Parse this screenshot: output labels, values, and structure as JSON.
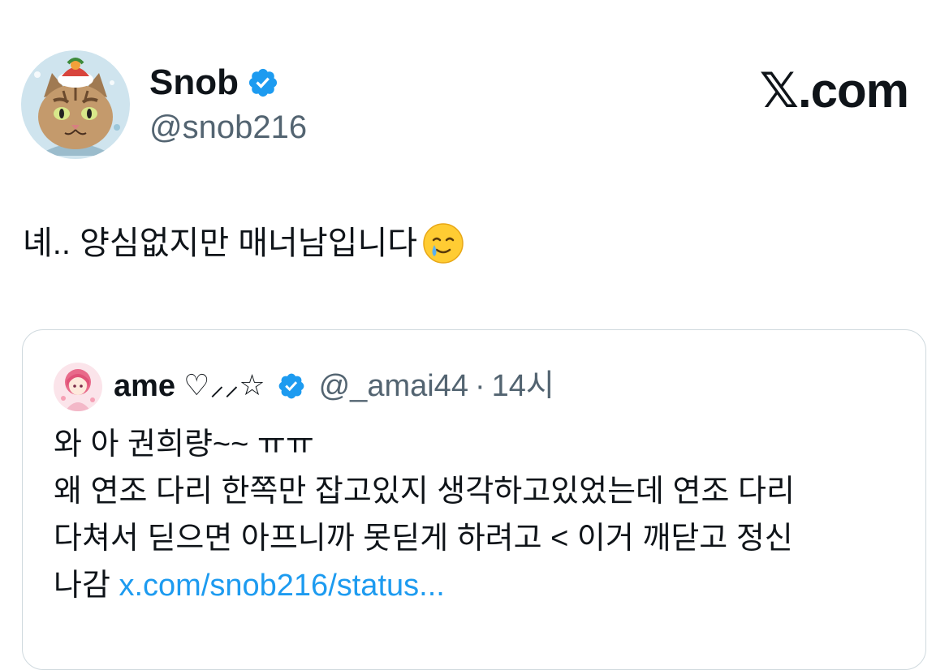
{
  "author": {
    "display_name": "Snob",
    "handle": "@snob216",
    "verified": true,
    "avatar_icon": "cat-avatar"
  },
  "brand": {
    "label": "𝕏.com"
  },
  "tweet": {
    "text": "녜.. 양심없지만 매너남입니다",
    "emoji": "smiling-face-with-tear-emoji"
  },
  "quote": {
    "display_name": "ame",
    "name_decoration": "♡⸝⸝☆",
    "verified": true,
    "handle": "@_amai44",
    "separator": "·",
    "timestamp": "14시",
    "avatar_icon": "anime-girl-avatar",
    "lines": [
      "와 아 권희량~~ ㅠㅠ",
      "왜 연조 다리 한쪽만 잡고있지 생각하고있었는데 연조 다리",
      "다쳐서 딛으면 아프니까 못딛게 하려고 < 이거 깨닫고 정신"
    ],
    "last_line_prefix": "나감",
    "link_text": "x.com/snob216/status..."
  },
  "colors": {
    "text_primary": "#0f1419",
    "text_secondary": "#536471",
    "link": "#1d9bf0",
    "verified_badge": "#1d9bf0",
    "card_border": "#cfd9de"
  }
}
